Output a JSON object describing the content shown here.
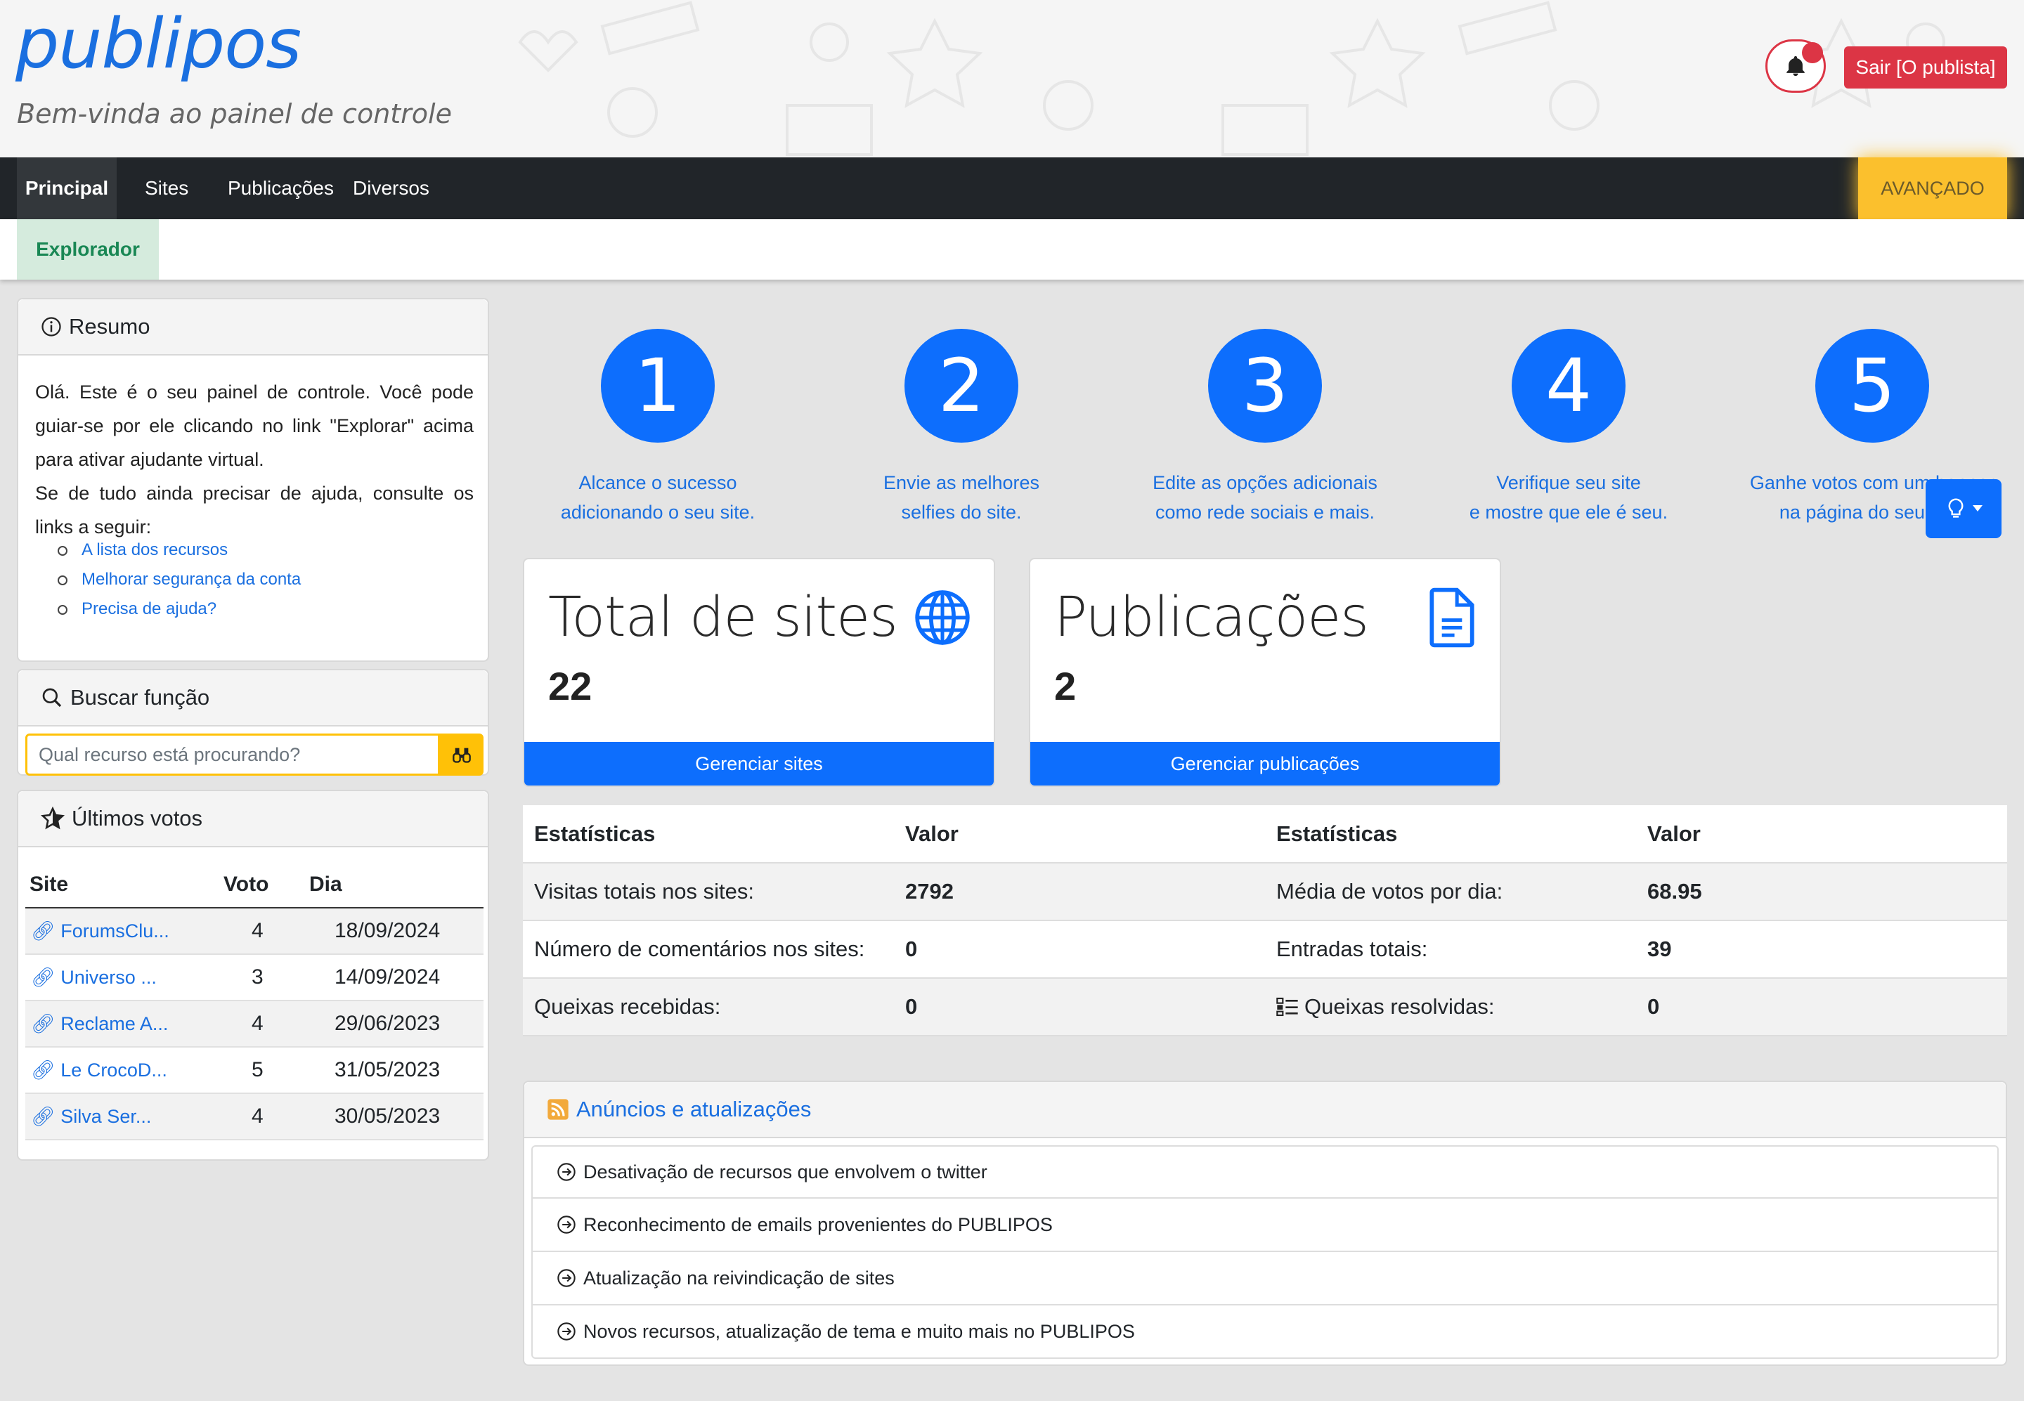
{
  "header": {
    "brand": "publipos",
    "subtitle": "Bem-vinda ao painel de controle",
    "logout_label": "Sair [O publista]"
  },
  "nav": {
    "items": [
      {
        "label": "Principal",
        "active": true
      },
      {
        "label": "Sites"
      },
      {
        "label": "Publicações"
      },
      {
        "label": "Diversos"
      }
    ],
    "advanced_label": "AVANÇADO",
    "sub_label": "Explorador"
  },
  "resumo": {
    "title": "Resumo",
    "text": "Olá. Este é o seu painel de controle. Você pode guiar-se por ele clicando no link \"Explorar\" acima para ativar ajudante virtual.\nSe de tudo ainda precisar de ajuda, consulte os links a seguir:",
    "links": [
      "A lista dos recursos",
      "Melhorar segurança da conta",
      "Precisa de ajuda?"
    ]
  },
  "busca": {
    "title": "Buscar função",
    "placeholder": "Qual recurso está procurando?"
  },
  "votos": {
    "title": "Últimos votos",
    "headers": [
      "Site",
      "Voto",
      "Dia"
    ],
    "rows": [
      {
        "site": "ForumsClu...",
        "voto": "4",
        "dia": "18/09/2024"
      },
      {
        "site": "Universo ...",
        "voto": "3",
        "dia": "14/09/2024"
      },
      {
        "site": "Reclame A...",
        "voto": "4",
        "dia": "29/06/2023"
      },
      {
        "site": "Le CrocoD...",
        "voto": "5",
        "dia": "31/05/2023"
      },
      {
        "site": "Silva Ser...",
        "voto": "4",
        "dia": "30/05/2023"
      }
    ]
  },
  "steps": [
    {
      "num": "1",
      "text": "Alcance o sucesso\nadicionando o seu site."
    },
    {
      "num": "2",
      "text": "Envie as melhores\nselfies do site."
    },
    {
      "num": "3",
      "text": "Edite as opções adicionais\ncomo rede sociais e mais."
    },
    {
      "num": "4",
      "text": "Verifique seu site\ne mostre que ele é seu."
    },
    {
      "num": "5",
      "text": "Ganhe votos com um banner\nna página do seu site."
    }
  ],
  "cards": {
    "sites": {
      "title": "Total de sites",
      "value": "22",
      "button": "Gerenciar sites"
    },
    "pubs": {
      "title": "Publicações",
      "value": "2",
      "button": "Gerenciar publicações"
    }
  },
  "stats": {
    "headers": [
      "Estatísticas",
      "Valor",
      "Estatísticas",
      "Valor"
    ],
    "rows": [
      [
        "Visitas totais nos sites:",
        "2792",
        "Média de votos por dia:",
        "68.95"
      ],
      [
        "Número de comentários nos sites:",
        "0",
        "Entradas totais:",
        "39"
      ],
      [
        "Queixas recebidas:",
        "0",
        "Queixas resolvidas:",
        "0"
      ]
    ]
  },
  "anuncios": {
    "title": "Anúncios e atualizações",
    "items": [
      "Desativação de recursos que envolvem o twitter",
      "Reconhecimento de emails provenientes do PUBLIPOS",
      "Atualização na reivindicação de sites",
      "Novos recursos, atualização de tema e muito mais no PUBLIPOS"
    ]
  },
  "colors": {
    "primary": "#0d6efd",
    "danger": "#dc3545",
    "warning": "#ffc107",
    "nav": "#212529"
  }
}
